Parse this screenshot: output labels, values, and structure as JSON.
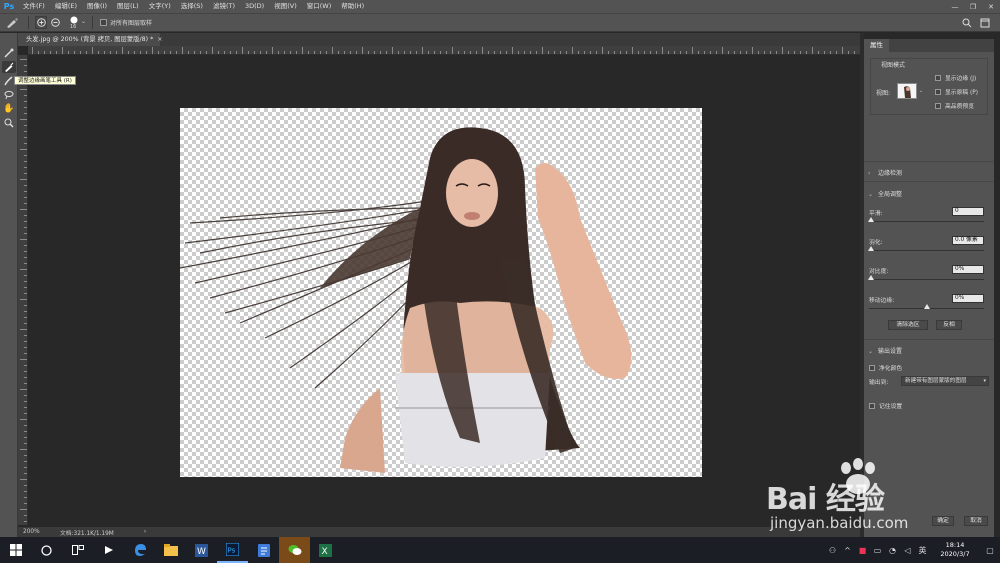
{
  "app": {
    "logo": "Ps"
  },
  "menubar": {
    "items": [
      "文件(F)",
      "编辑(E)",
      "图像(I)",
      "图层(L)",
      "文字(Y)",
      "选择(S)",
      "滤镜(T)",
      "3D(D)",
      "视图(V)",
      "窗口(W)",
      "帮助(H)"
    ],
    "window_controls": {
      "minimize": "—",
      "restore": "❐",
      "close": "✕"
    }
  },
  "options_bar": {
    "brush_size": "16",
    "sample_all_layers_label": "对所有图层取样",
    "sample_all_layers_checked": false
  },
  "document": {
    "tab_title": "头发.jpg @ 200% (背景 拷贝, 图层蒙版/8) *",
    "tab_close": "×"
  },
  "toolbar": {
    "tools": [
      "quick-selection-icon",
      "refine-edge-brush-icon",
      "brush-icon",
      "lasso-icon",
      "hand-icon",
      "zoom-icon"
    ],
    "active_tool": "refine-edge-brush-icon",
    "tooltip": "调整边缘画笔工具 (R)"
  },
  "status": {
    "zoom": "200%",
    "doc_size": "文档:321.1K/1.19M",
    "arrow": "›"
  },
  "properties": {
    "tab": "属性",
    "view_mode": {
      "title": "视图模式",
      "view_label": "视图:",
      "show_edge": "显示边缘 (J)",
      "show_original": "显示原稿 (P)",
      "high_quality_preview": "高品质预览"
    },
    "edge_detection": {
      "title": "边缘检测",
      "collapsed": true
    },
    "global_refinement": {
      "title": "全局调整",
      "smooth": {
        "label": "平滑:",
        "value": "0"
      },
      "feather": {
        "label": "羽化:",
        "value": "0.0 像素"
      },
      "contrast": {
        "label": "对比度:",
        "value": "0%"
      },
      "shift_edge": {
        "label": "移动边缘:",
        "value": "0%"
      },
      "clear_selection": "清除选区",
      "invert": "反相"
    },
    "output_settings": {
      "title": "输出设置",
      "decontaminate_colors": "净化颜色",
      "output_to_label": "输出到:",
      "output_to_value": "新建带有图层蒙版的图层",
      "remember_settings": "记住设置"
    },
    "ok": "确定",
    "cancel": "取消"
  },
  "taskbar": {
    "icons": [
      "windows-start-icon",
      "cortana-icon",
      "task-view-icon",
      "bilibili-icon",
      "edge-icon",
      "file-explorer-icon",
      "word-icon",
      "photoshop-icon",
      "notes-icon",
      "wechat-icon",
      "excel-icon"
    ],
    "time": "18:14",
    "date": "2020/3/7"
  },
  "watermark": {
    "text": "Bai 经验",
    "sub": "jingyan.baidu.com"
  }
}
